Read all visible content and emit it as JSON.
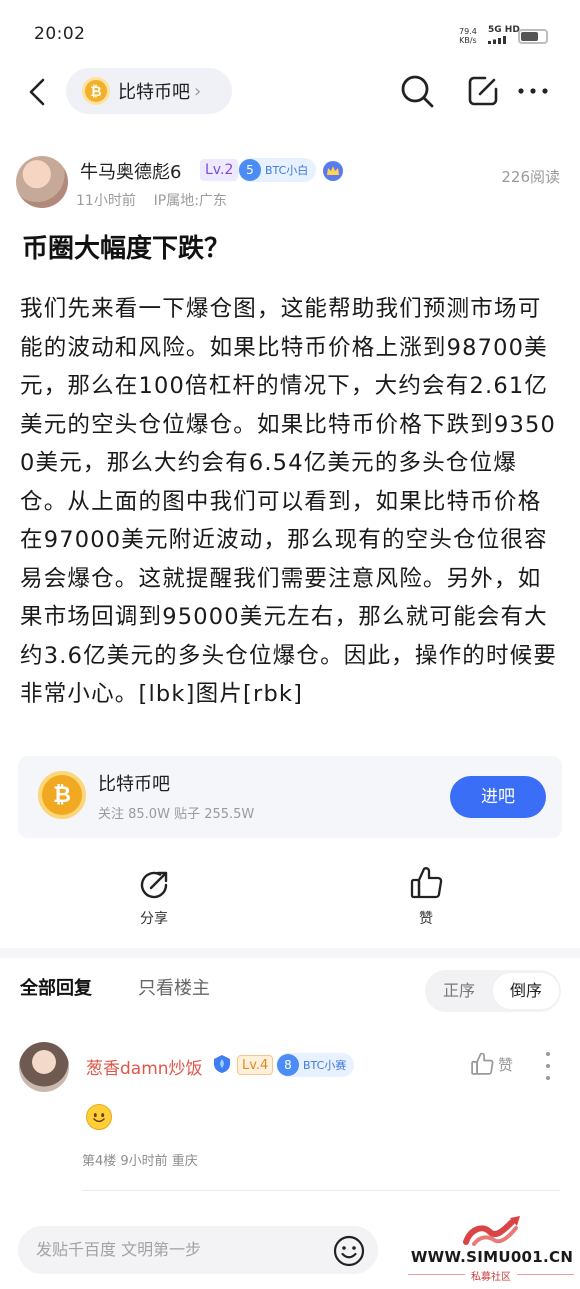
{
  "status_bar": {
    "time": "20:02",
    "net_speed": "79.4",
    "net_unit": "KB/s",
    "network": "5G HD",
    "battery_level": 0.7
  },
  "nav": {
    "forum_name": "比特币吧",
    "icons": [
      "back-icon",
      "search-icon",
      "edit-icon",
      "more-icon"
    ]
  },
  "post": {
    "author": "牛马奥德彪6",
    "level": "Lv.2",
    "fan_level": "5",
    "fan_label": "BTC小白",
    "time_ago": "11小时前",
    "ip_location": "IP属地:广东",
    "read_count": "226阅读",
    "title": "币圈大幅度下跌？",
    "body": "我们先来看一下爆仓图，这能帮助我们预测市场可能的波动和风险。如果比特币价格上涨到98700美元，那么在100倍杠杆的情况下，大约会有2.61亿美元的空头仓位爆仓。如果比特币价格下跌到93500美元，那么大约会有6.54亿美元的多头仓位爆仓。从上面的图中我们可以看到，如果比特币价格在97000美元附近波动，那么现有的空头仓位很容易会爆仓。这就提醒我们需要注意风险。另外，如果市场回调到95000美元左右，那么就可能会有大约3.6亿美元的多头仓位爆仓。因此，操作的时候要非常小心。[lbk]图片[rbk]"
  },
  "forum_card": {
    "name": "比特币吧",
    "stats": "关注 85.0W  贴子 255.5W",
    "join_label": "进吧",
    "accent": "#3b6ef6"
  },
  "actions": {
    "share_label": "分享",
    "like_label": "赞"
  },
  "replies": {
    "tab_all": "全部回复",
    "tab_owner": "只看楼主",
    "sort_asc": "正序",
    "sort_desc": "倒序",
    "items": [
      {
        "user": "葱香damn炒饭",
        "level": "Lv.4",
        "fan_level": "8",
        "fan_label": "BTC小赛",
        "like_label": "赞",
        "floor_meta": "第4楼  9小时前  重庆"
      }
    ]
  },
  "bottom": {
    "input_placeholder": "发贴千百度 文明第一步"
  },
  "watermark": {
    "url": "WWW.SIMU001.CN",
    "sub": "私募社区"
  }
}
